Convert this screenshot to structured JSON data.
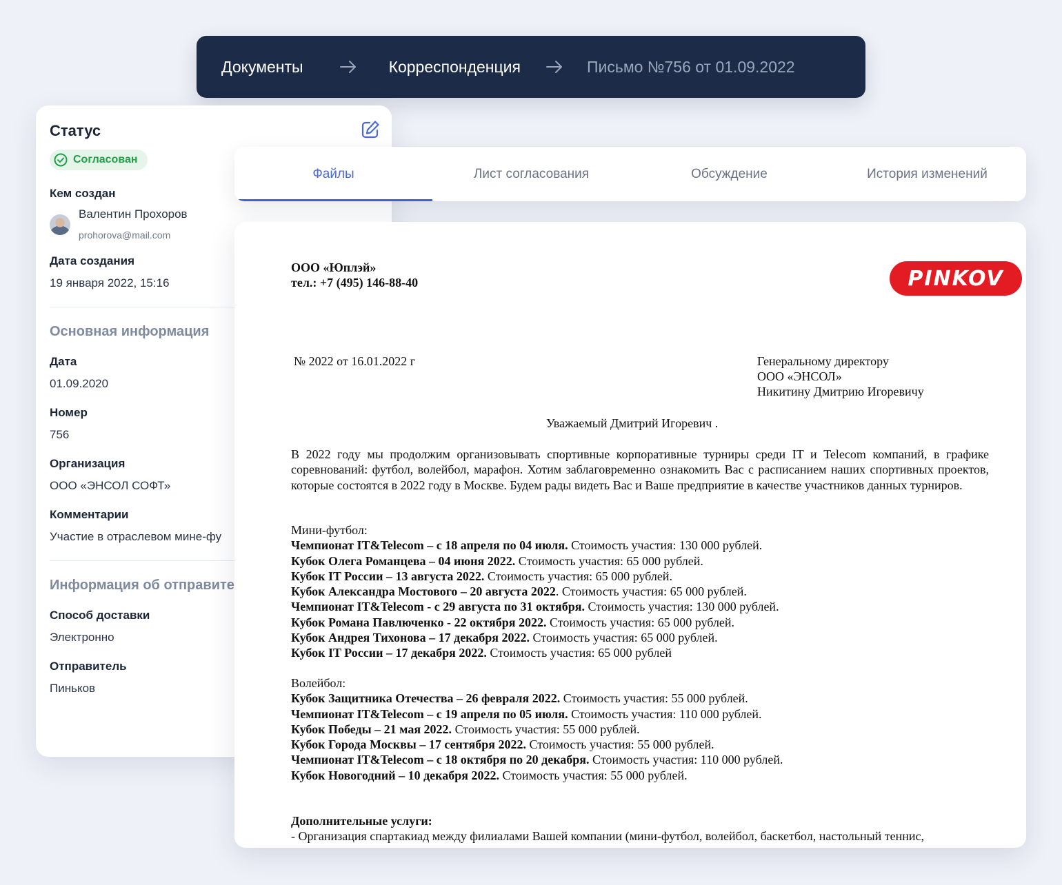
{
  "breadcrumb": {
    "items": [
      "Документы",
      "Корреспонденция",
      "Письмо №756 от 01.09.2022"
    ]
  },
  "status_card": {
    "title": "Статус",
    "status": "Согласован",
    "created_by_label": "Кем создан",
    "user_name": "Валентин Прохоров",
    "user_email": "prohorova@mail.com",
    "created_date_label": "Дата создания",
    "created_date": "19 января 2022, 15:16",
    "main_info_title": "Основная информация",
    "date_label": "Дата",
    "date": "01.09.2020",
    "number_label": "Номер",
    "number": "756",
    "org_label": "Организация",
    "org": "ООО «ЭНСОЛ СОФТ»",
    "comments_label": "Комментарии",
    "comments": "Участие в отраслевом мине-фу",
    "sender_info_title": "Информация об отправите",
    "delivery_label": "Способ доставки",
    "delivery": "Электронно",
    "sender_label": "Отправитель",
    "sender": "Пиньков"
  },
  "tabs": [
    "Файлы",
    "Лист согласования",
    "Обсуждение",
    "История изменений"
  ],
  "document": {
    "company": "ООО «Юплэй»",
    "phone": "тел.: +7 (495) 146-88-40",
    "logo_text": "PINKOV",
    "ref": "№ 2022 от 16.01.2022 г",
    "addressee": [
      "Генеральному директору",
      "ООО «ЭНСОЛ»",
      "Никитину Дмитрию Игоревичу"
    ],
    "greeting": "Уважаемый Дмитрий Игоревич .",
    "intro": "В 2022 году мы продолжим организовывать спортивные корпоративные турниры среди IT и Telecom компаний, в графике соревнований: футбол, волейбол, марафон. Хотим заблаговременно ознакомить Вас с расписанием наших спортивных проектов, которые состоятся в 2022 году в Москве. Будем рады видеть Вас и Ваше предприятие в качестве участников данных турниров.",
    "football_title": "Мини-футбол:",
    "football": [
      {
        "bold": "Чемпионат IT&Telecom – с 18 апреля по 04 июля.",
        "rest": " Стоимость участия: 130 000 рублей."
      },
      {
        "bold": "Кубок Олега Романцева – 04 июня 2022.",
        "rest": " Стоимость участия: 65 000 рублей."
      },
      {
        "bold": "Кубок IT России – 13 августа 2022.",
        "rest": " Стоимость участия: 65 000 рублей."
      },
      {
        "bold": "Кубок Александра Мостового – 20 августа 2022",
        "rest": ". Стоимость участия: 65 000 рублей."
      },
      {
        "bold": "Чемпионат IT&Telecom - с 29 августа по 31 октября.",
        "rest": "  Стоимость участия: 130 000 рублей."
      },
      {
        "bold": "Кубок Романа Павлюченко - 22 октября 2022.",
        "rest": " Стоимость участия: 65 000 рублей."
      },
      {
        "bold": "Кубок Андрея Тихонова – 17 декабря 2022.",
        "rest": " Стоимость участия: 65 000 рублей."
      },
      {
        "bold": "Кубок IT России – 17 декабря 2022.",
        "rest": " Стоимость участия: 65 000 рублей"
      }
    ],
    "volleyball_title": "Волейбол:",
    "volleyball": [
      {
        "bold": "Кубок Защитника Отечества – 26 февраля 2022.",
        "rest": " Стоимость участия: 55 000 рублей."
      },
      {
        "bold": "Чемпионат IT&Telecom – с 19 апреля по 05 июля.",
        "rest": " Стоимость участия: 110 000 рублей."
      },
      {
        "bold": "Кубок Победы – 21 мая 2022.",
        "rest": " Стоимость участия: 55 000 рублей."
      },
      {
        "bold": "Кубок Города Москвы – 17 сентября 2022.",
        "rest": " Стоимость участия: 55 000 рублей."
      },
      {
        "bold": "Чемпионат IT&Telecom – с 18 октября по 20 декабря.",
        "rest": " Стоимость участия: 110 000 рублей."
      },
      {
        "bold": "Кубок Новогодний – 10 декабря 2022.",
        "rest": " Стоимость участия: 55 000 рублей."
      }
    ],
    "extra_title": "Дополнительные услуги:",
    "extra_line": "- Организация спартакиад между филиалами Вашей компании (мини-футбол, волейбол, баскетбол, настольный теннис,"
  }
}
